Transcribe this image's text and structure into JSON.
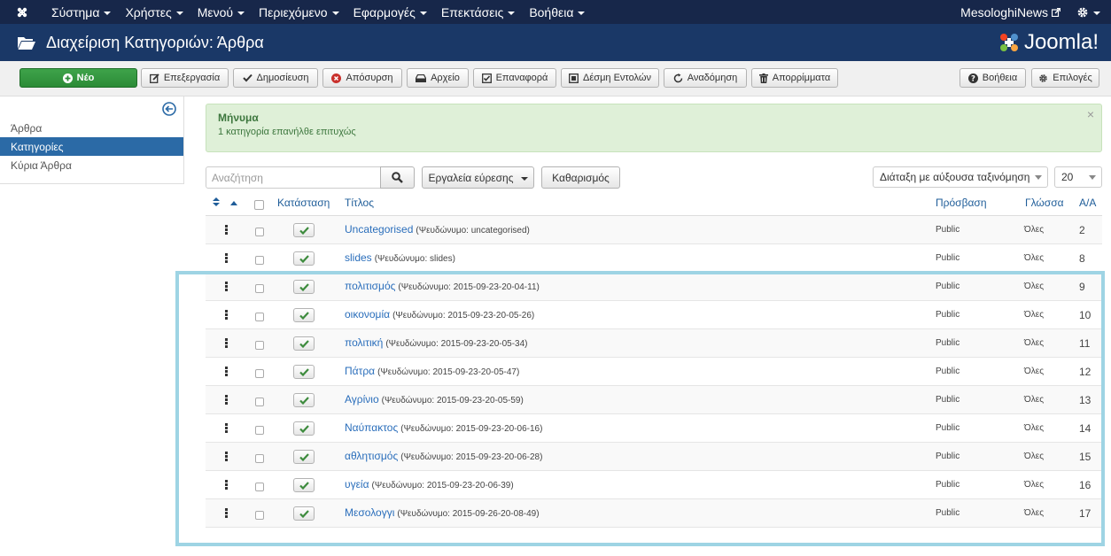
{
  "navbar": {
    "menu": [
      {
        "label": "Σύστημα"
      },
      {
        "label": "Χρήστες"
      },
      {
        "label": "Μενού"
      },
      {
        "label": "Περιεχόμενο"
      },
      {
        "label": "Εφαρμογές"
      },
      {
        "label": "Επεκτάσεις"
      },
      {
        "label": "Βοήθεια"
      }
    ],
    "site_name": "MesologhiNews"
  },
  "header": {
    "title": "Διαχείριση Κατηγοριών: Άρθρα",
    "logo_text": "Joomla!"
  },
  "toolbar": {
    "new": "Νέο",
    "edit": "Επεξεργασία",
    "publish": "Δημοσίευση",
    "unpublish": "Απόσυρση",
    "archive": "Αρχείο",
    "checkin": "Επαναφορά",
    "batch": "Δέσμη Εντολών",
    "rebuild": "Αναδόμηση",
    "trash": "Απορρίμματα",
    "help": "Βοήθεια",
    "options": "Επιλογές"
  },
  "sidebar": {
    "items": [
      {
        "label": "Άρθρα",
        "active": false
      },
      {
        "label": "Κατηγορίες",
        "active": true
      },
      {
        "label": "Κύρια Άρθρα",
        "active": false
      }
    ]
  },
  "message": {
    "title": "Μήνυμα",
    "text": "1 κατηγορία επανήλθε επιτυχώς"
  },
  "filters": {
    "search_placeholder": "Αναζήτηση",
    "search_tools": "Εργαλεία εύρεσης",
    "clear": "Καθαρισμός",
    "ordering": "Διάταξη με αύξουσα ταξινόμηση",
    "limit": "20"
  },
  "table": {
    "headers": {
      "status": "Κατάσταση",
      "title": "Τίτλος",
      "access": "Πρόσβαση",
      "language": "Γλώσσα",
      "id": "Α/Α"
    },
    "rows": [
      {
        "title": "Uncategorised",
        "alias": "(Ψευδώνυμο: uncategorised)",
        "access": "Public",
        "language": "Όλες",
        "id": "2"
      },
      {
        "title": "slides",
        "alias": "(Ψευδώνυμο: slides)",
        "access": "Public",
        "language": "Όλες",
        "id": "8"
      },
      {
        "title": "πολιτισμός",
        "alias": "(Ψευδώνυμο: 2015-09-23-20-04-11)",
        "access": "Public",
        "language": "Όλες",
        "id": "9"
      },
      {
        "title": "οικονομία",
        "alias": "(Ψευδώνυμο: 2015-09-23-20-05-26)",
        "access": "Public",
        "language": "Όλες",
        "id": "10"
      },
      {
        "title": "πολιτική",
        "alias": "(Ψευδώνυμο: 2015-09-23-20-05-34)",
        "access": "Public",
        "language": "Όλες",
        "id": "11"
      },
      {
        "title": "Πάτρα",
        "alias": "(Ψευδώνυμο: 2015-09-23-20-05-47)",
        "access": "Public",
        "language": "Όλες",
        "id": "12"
      },
      {
        "title": "Αγρίνιο",
        "alias": "(Ψευδώνυμο: 2015-09-23-20-05-59)",
        "access": "Public",
        "language": "Όλες",
        "id": "13"
      },
      {
        "title": "Ναύπακτος",
        "alias": "(Ψευδώνυμο: 2015-09-23-20-06-16)",
        "access": "Public",
        "language": "Όλες",
        "id": "14"
      },
      {
        "title": "αθλητισμός",
        "alias": "(Ψευδώνυμο: 2015-09-23-20-06-28)",
        "access": "Public",
        "language": "Όλες",
        "id": "15"
      },
      {
        "title": "υγεία",
        "alias": "(Ψευδώνυμο: 2015-09-23-20-06-39)",
        "access": "Public",
        "language": "Όλες",
        "id": "16"
      },
      {
        "title": "Μεσολογγι",
        "alias": "(Ψευδώνυμο: 2015-09-26-20-08-49)",
        "access": "Public",
        "language": "Όλες",
        "id": "17"
      }
    ]
  },
  "colors": {
    "navbar": "#17274a",
    "header": "#1a3867",
    "new_button": "#3ea34a",
    "sidebar_active": "#2b6aa6",
    "link": "#2a6ebb",
    "success_bg": "#dff0d8",
    "highlight": "#9ed4e4"
  },
  "icons": {
    "brand": "joomla-icon",
    "header": "folder-open-icon",
    "status": "check-icon",
    "search": "search-icon",
    "settings": "gear-icon",
    "external": "external-link-icon"
  }
}
